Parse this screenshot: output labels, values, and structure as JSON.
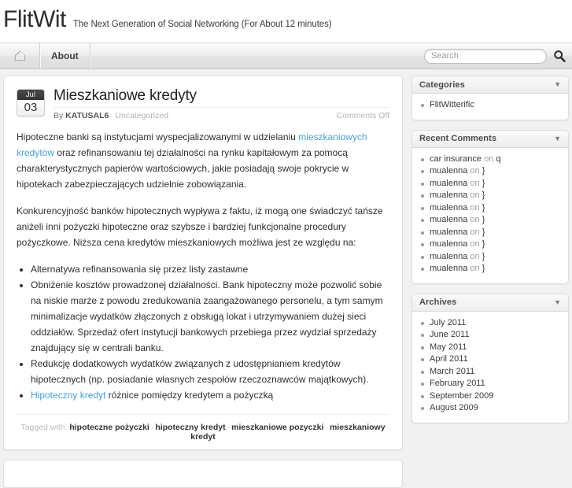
{
  "site": {
    "title_part1": "Flit",
    "title_part2": "Wit",
    "tagline": "The Next Generation of Social Networking (For About 12 minutes)"
  },
  "nav": {
    "home_icon": "home-icon",
    "items": [
      {
        "label": "About"
      }
    ]
  },
  "search": {
    "placeholder": "Search",
    "value": "",
    "button_icon": "search-icon"
  },
  "post": {
    "date": {
      "month": "Jul",
      "day": "03"
    },
    "title": "Mieszkaniowe kredyty",
    "meta": {
      "by_prefix": "By ",
      "author": "KATUSAL6",
      "category": "Uncategorized",
      "comments": "Comments Off"
    },
    "paragraph1_a": "Hipoteczne banki są instytucjami wyspecjalizowanymi w udzielaniu ",
    "paragraph1_link": "mieszkaniowych kredytów",
    "paragraph1_b": " oraz refinansowaniu tej działalności na rynku kapitałowym za pomocą charakterystycznych papierów wartościowych, jakie posiadają swoje pokrycie w hipotekach zabezpieczających udzielnie zobowiązania.",
    "paragraph2": "Konkurencyjność banków hipotecznych wypływa z faktu, iż mogą one świadczyć tańsze aniżeli inni pożyczki hipoteczne oraz szybsze i bardziej funkcjonalne procedury pożyczkowe. Niższa cena kredytów mieszkaniowych możliwa jest ze względu na:",
    "bullets": [
      "Alternatywa refinansowania się przez listy zastawne",
      "Obniżenie kosztów prowadzonej działalności. Bank hipoteczny może pozwolić sobie na niskie marże z powodu zredukowania zaangażowanego personelu, a tym samym minimalizacje wydatków złączonych z obsługą lokat i utrzymywaniem dużej sieci oddziałów. Sprzedaż ofert instytucji bankowych przebiega przez wydział sprzedaży znajdujący się w centrali banku.",
      "Redukcję dodatkowych wydatków związanych z udostępnianiem kredytów hipotecznych (np. posiadanie własnych zespołów rzeczoznawców majątkowych)."
    ],
    "bullet_link_label": "Hipoteczny kredyt",
    "bullet_link_rest": " różnice pomiędzy kredytem a pożyczką",
    "tagged_label": "Tagged with:",
    "tags": [
      "hipoteczne pożyczki",
      "hipoteczny kredyt",
      "mieszkaniowe pozyczki",
      "mieszkaniowy kredyt"
    ],
    "tag_separator": "·"
  },
  "sidebar": {
    "widgets": [
      {
        "title": "Categories",
        "toggle": "▼",
        "items": [
          {
            "subject": "FlitWitterific"
          }
        ]
      },
      {
        "title": "Recent Comments",
        "toggle": "▼",
        "items": [
          {
            "subject": "car insurance",
            "on": "on",
            "target": "q"
          },
          {
            "subject": "mualenna",
            "on": "on",
            "target": "}"
          },
          {
            "subject": "mualenna",
            "on": "on",
            "target": "}"
          },
          {
            "subject": "mualenna",
            "on": "on",
            "target": "}"
          },
          {
            "subject": "mualenna",
            "on": "on",
            "target": "}"
          },
          {
            "subject": "mualenna",
            "on": "on",
            "target": "}"
          },
          {
            "subject": "mualenna",
            "on": "on",
            "target": "}"
          },
          {
            "subject": "mualenna",
            "on": "on",
            "target": "}"
          },
          {
            "subject": "mualenna",
            "on": "on",
            "target": "}"
          },
          {
            "subject": "mualenna",
            "on": "on",
            "target": "}"
          }
        ]
      },
      {
        "title": "Archives",
        "toggle": "▼",
        "items": [
          {
            "subject": "July 2011"
          },
          {
            "subject": "June 2011"
          },
          {
            "subject": "May 2011"
          },
          {
            "subject": "April 2011"
          },
          {
            "subject": "March 2011"
          },
          {
            "subject": "February 2011"
          },
          {
            "subject": "September 2009"
          },
          {
            "subject": "August 2009"
          }
        ]
      }
    ]
  },
  "colors": {
    "link": "#4a9fd4",
    "page_bg": "#f1f1f1",
    "card_bg": "#ffffff"
  }
}
